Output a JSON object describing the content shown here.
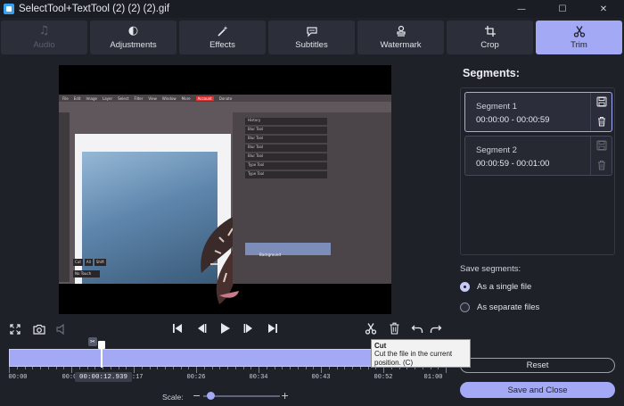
{
  "window": {
    "title": "SelectTool+TextTool (2) (2) (2).gif",
    "minimize": "—",
    "maximize": "☐",
    "close": "✕"
  },
  "tabs": [
    {
      "label": "Audio",
      "icon": "music-note-icon",
      "glyph": "♫",
      "state": "disabled"
    },
    {
      "label": "Adjustments",
      "icon": "contrast-icon",
      "glyph": "◐",
      "state": "normal"
    },
    {
      "label": "Effects",
      "icon": "magic-wand-icon",
      "glyph": "✨",
      "state": "normal"
    },
    {
      "label": "Subtitles",
      "icon": "speech-bubble-icon",
      "glyph": "💬",
      "state": "normal"
    },
    {
      "label": "Watermark",
      "icon": "stamp-icon",
      "glyph": "⚲",
      "state": "normal"
    },
    {
      "label": "Crop",
      "icon": "crop-icon",
      "glyph": "⟳",
      "state": "normal"
    },
    {
      "label": "Trim",
      "icon": "scissors-icon",
      "glyph": "✂",
      "state": "active"
    }
  ],
  "preview": {
    "menu_items": [
      "File",
      "Edit",
      "Image",
      "Layer",
      "Select",
      "Filter",
      "View",
      "Window",
      "More",
      "Account",
      "Donate"
    ],
    "panel_rows": [
      "History",
      "Swatches",
      "Blur Tool",
      "Blur Tool",
      "Blur Tool",
      "Blur Tool",
      "Type Tool",
      "Type Tool"
    ],
    "layer_name": "Background",
    "popup_items": [
      "Cut",
      "All",
      "Shift"
    ],
    "popup_tip": "No Touch"
  },
  "segments_panel": {
    "title": "Segments:",
    "segments": [
      {
        "name": "Segment 1",
        "time": "00:00:00 - 00:00:59",
        "selected": true
      },
      {
        "name": "Segment 2",
        "time": "00:00:59 - 00:01:00",
        "selected": false
      }
    ],
    "save_label": "Save segments:",
    "options": [
      {
        "label": "As a single file",
        "checked": true
      },
      {
        "label": "As separate files",
        "checked": false
      }
    ],
    "reset_label": "Reset",
    "save_close_label": "Save and Close"
  },
  "timeline": {
    "current_time": "00:00:12.939",
    "tick_labels": [
      "00:00",
      "00:08",
      "00:17",
      "00:26",
      "00:34",
      "00:43",
      "00:52",
      "01:00"
    ],
    "playhead_fraction": 0.214
  },
  "scale": {
    "label": "Scale:",
    "minus": "−",
    "plus": "+",
    "value_fraction": 0.05
  },
  "tooltip": {
    "title": "Cut",
    "body": "Cut the file in the current position. (C)"
  },
  "colors": {
    "accent": "#a3a9f5",
    "background": "#1f2129",
    "tab_bg": "#2c2f3a"
  }
}
